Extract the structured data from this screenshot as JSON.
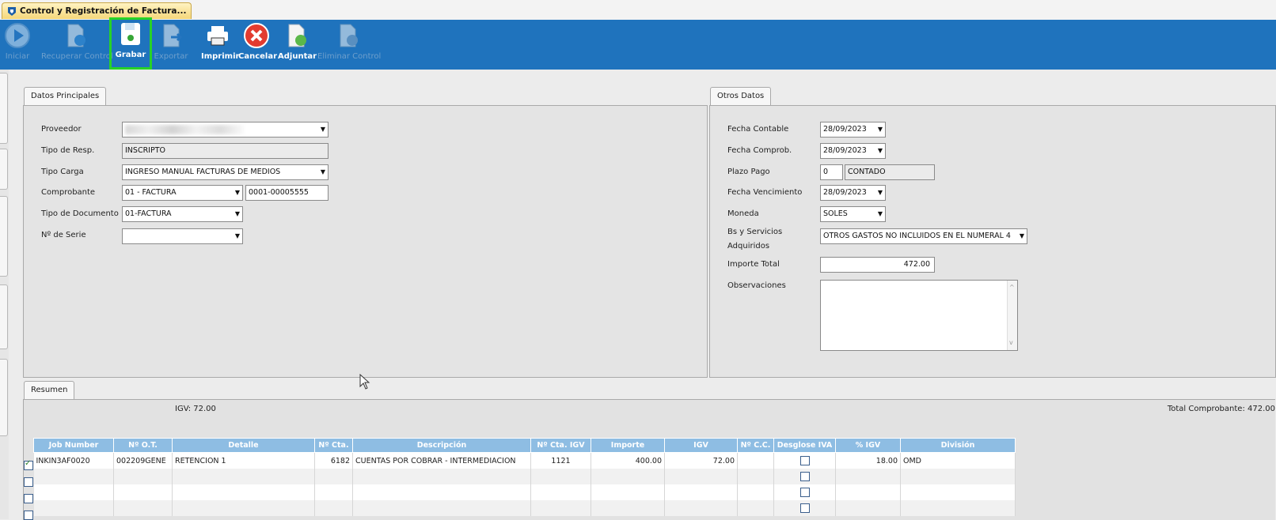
{
  "window": {
    "tab_title": "Control y Registración de Factura..."
  },
  "toolbar": {
    "buttons": [
      {
        "label": "Iniciar",
        "enabled": false
      },
      {
        "label": "Recuperar Control",
        "enabled": false
      },
      {
        "label": "Grabar",
        "enabled": true,
        "highlighted": true
      },
      {
        "label": "Exportar",
        "enabled": false
      },
      {
        "label": "Imprimir",
        "enabled": true
      },
      {
        "label": "Cancelar",
        "enabled": true
      },
      {
        "label": "Adjuntar",
        "enabled": true
      },
      {
        "label": "Eliminar Control",
        "enabled": false
      }
    ]
  },
  "datos_principales": {
    "tab": "Datos Principales",
    "proveedor": {
      "label": "Proveedor",
      "value": ""
    },
    "tipo_resp": {
      "label": "Tipo de Resp.",
      "value": "INSCRIPTO"
    },
    "tipo_carga": {
      "label": "Tipo Carga",
      "value": "INGRESO MANUAL FACTURAS DE MEDIOS"
    },
    "comprobante": {
      "label": "Comprobante",
      "value": "01 - FACTURA",
      "numero": "0001-00005555"
    },
    "tipo_documento": {
      "label": "Tipo de Documento",
      "value": "01-FACTURA"
    },
    "nro_serie": {
      "label": "Nº de Serie",
      "value": ""
    }
  },
  "otros_datos": {
    "tab": "Otros Datos",
    "fecha_contable": {
      "label": "Fecha Contable",
      "value": "28/09/2023"
    },
    "fecha_comprob": {
      "label": "Fecha Comprob.",
      "value": "28/09/2023"
    },
    "plazo_pago": {
      "label": "Plazo Pago",
      "days": "0",
      "desc": "CONTADO"
    },
    "fecha_vencimiento": {
      "label": "Fecha Vencimiento",
      "value": "28/09/2023"
    },
    "moneda": {
      "label": "Moneda",
      "value": "SOLES"
    },
    "bs_servicios": {
      "label_1": "Bs y Servicios",
      "label_2": "Adquiridos",
      "value": "OTROS GASTOS NO INCLUIDOS EN EL NUMERAL 4"
    },
    "importe_total": {
      "label": "Importe Total",
      "value": "472.00"
    },
    "observaciones": {
      "label": "Observaciones",
      "value": ""
    }
  },
  "resumen": {
    "tab": "Resumen",
    "igv": "IGV: 72.00",
    "total_comprobante": "Total Comprobante: 472.00",
    "columns": [
      "Job Number",
      "Nº O.T.",
      "Detalle",
      "Nº Cta.",
      "Descripción",
      "Nº Cta. IGV",
      "Importe",
      "IGV",
      "Nº C.C.",
      "Desglose IVA",
      "% IGV",
      "División"
    ],
    "rows": [
      {
        "checked": true,
        "job": "INKIN3AF0020",
        "ot": "002209GENE",
        "detalle": "RETENCION 1",
        "cta": "6182",
        "descripcion": "CUENTAS POR COBRAR - INTERMEDIACION",
        "cta_igv": "1121",
        "importe": "400.00",
        "igv": "72.00",
        "cc": "",
        "desglose": false,
        "pct_igv": "18.00",
        "division": "OMD"
      },
      {
        "checked": false,
        "job": "",
        "ot": "",
        "detalle": "",
        "cta": "",
        "descripcion": "",
        "cta_igv": "",
        "importe": "",
        "igv": "",
        "cc": "",
        "desglose": false,
        "pct_igv": "",
        "division": ""
      },
      {
        "checked": false,
        "job": "",
        "ot": "",
        "detalle": "",
        "cta": "",
        "descripcion": "",
        "cta_igv": "",
        "importe": "",
        "igv": "",
        "cc": "",
        "desglose": false,
        "pct_igv": "",
        "division": ""
      },
      {
        "checked": false,
        "job": "",
        "ot": "",
        "detalle": "",
        "cta": "",
        "descripcion": "",
        "cta_igv": "",
        "importe": "",
        "igv": "",
        "cc": "",
        "desglose": false,
        "pct_igv": "",
        "division": ""
      }
    ]
  },
  "colors": {
    "toolbar": "#1f73bd",
    "grid_header": "#8ebde3",
    "highlight": "#27d227"
  }
}
